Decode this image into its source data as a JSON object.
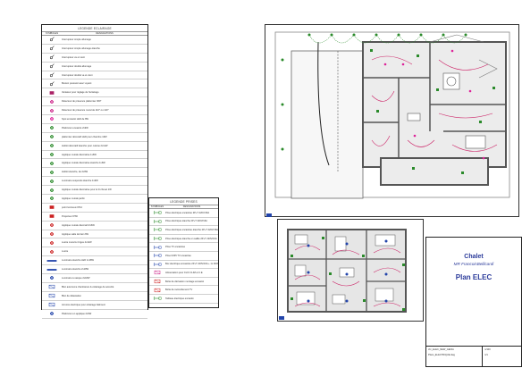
{
  "legend_eclairage": {
    "title": "LEGENDE ECLAIRAGE",
    "col_symbols": "SYMBOLES",
    "col_designations": "DESIGNATIONS",
    "items": [
      {
        "label": "Interrupteur simple allumage",
        "icon": "switch-single-icon",
        "color": "#222222"
      },
      {
        "label": "Interrupteur simple allumage étanche",
        "icon": "switch-waterproof-icon",
        "color": "#222222"
      },
      {
        "label": "Interrupteur va et vient",
        "icon": "switch-two-way-icon",
        "color": "#222222"
      },
      {
        "label": "Interrupteur double allumage",
        "icon": "switch-double-icon",
        "color": "#222222"
      },
      {
        "label": "Interrupteur double va et vient",
        "icon": "switch-double-two-way-icon",
        "color": "#222222"
      },
      {
        "label": "Bouton poussoir avec voyant",
        "icon": "push-button-icon",
        "color": "#222222"
      },
      {
        "label": "Variateur pour réglage de l'éclairage",
        "icon": "dimmer-icon",
        "color": "#aa2266"
      },
      {
        "label": "Détecteur de présence plafonnier 360°",
        "icon": "detector-360-icon",
        "color": "#cc2288"
      },
      {
        "label": "Détecteur de présence mural de 110° ou 120°",
        "icon": "detector-wall-icon",
        "color": "#cc2288"
      },
      {
        "label": "Spot encastré LED de 8W",
        "icon": "spot-led-icon",
        "color": "#dd2299"
      },
      {
        "label": "Plafonnier encastré 2x9W",
        "icon": "ceiling-recessed-icon",
        "color": "#2a8a2a"
      },
      {
        "label": "plafonnier décoratif LED pour chambre 16W",
        "icon": "ceiling-decor-icon",
        "color": "#2a8a2a"
      },
      {
        "label": "Hublot décoratif étanche pour cuisine 2x11W",
        "icon": "porthole-icon",
        "color": "#2a8a2a"
      },
      {
        "label": "Applique murale décorative 1x6W",
        "icon": "wall-light-icon",
        "color": "#2a8a2a"
      },
      {
        "label": "Applique murale décorative étanche 1x6W",
        "icon": "wall-light-waterproof-icon",
        "color": "#2a8a2a"
      },
      {
        "label": "Hublot étanche, de 2x9W",
        "icon": "porthole-waterproof-icon",
        "color": "#2a8a2a"
      },
      {
        "label": "Luminaire suspendu étanche 1x9W",
        "icon": "pendant-waterproof-icon",
        "color": "#2a8a2a"
      },
      {
        "label": "Applique murale décorative pour le lit chevet 1W",
        "icon": "bedside-light-icon",
        "color": "#2a8a2a"
      },
      {
        "label": "Applique murale jardin",
        "icon": "garden-light-icon",
        "color": "#2a8a2a"
      },
      {
        "label": "point lumineux IP44",
        "icon": "light-point-icon",
        "color": "#cc2222"
      },
      {
        "label": "Projecteur IP66",
        "icon": "projector-icon",
        "color": "#cc2222"
      },
      {
        "label": "Applique murale décoratif 2x6W",
        "icon": "wall-decor-icon",
        "color": "#cc2222"
      },
      {
        "label": "Applique salle de bain 6W",
        "icon": "bathroom-light-icon",
        "color": "#cc2222"
      },
      {
        "label": "Lustre mural à 4 tiges 4x11W",
        "icon": "chandelier-wall-icon",
        "color": "#cc2222"
      },
      {
        "label": "Lustre",
        "icon": "chandelier-icon",
        "color": "#cc2222"
      },
      {
        "label": "Luminaire étanche LED 1x18W",
        "icon": "led-batten-icon",
        "color": "#2244aa"
      },
      {
        "label": "Luminaire étanche 2x18W",
        "icon": "batten-double-icon",
        "color": "#2244aa"
      },
      {
        "label": "Luminaire à vasque 2x18W",
        "icon": "basin-light-icon",
        "color": "#2244aa"
      },
      {
        "label": "Bloc autonome d'ambiance & éclairage de sécurité",
        "icon": "emergency-block-icon",
        "color": "#2244aa"
      },
      {
        "label": "Bloc de délestation",
        "icon": "shedding-block-icon",
        "color": "#2244aa"
      },
      {
        "label": "Armoire électrique pour éclairage bâtiment",
        "icon": "electric-cabinet-icon",
        "color": "#2244aa"
      },
      {
        "label": "Plafonnier en applique 2x9W",
        "icon": "ceiling-wall-icon",
        "color": "#2244aa"
      }
    ]
  },
  "legend_prises": {
    "title": "LEGENDE PRISES",
    "col_symbols": "SYMBOLES",
    "col_designations": "DESIGNATIONS",
    "items": [
      {
        "label": "Prise électrique encastrée 2P+T 220V/16A",
        "icon": "outlet-icon",
        "color": "#2a8a2a"
      },
      {
        "label": "Prise électrique étanche 2P+T 220V/16A",
        "icon": "outlet-waterproof-icon",
        "color": "#2a8a2a"
      },
      {
        "label": "Prise électrique encastrée étanche 2P+T 220V/16A",
        "icon": "outlet-recessed-waterproof-icon",
        "color": "#2a8a2a"
      },
      {
        "label": "Prise électrique étanche en saillie 2P+T 220V/16A",
        "icon": "outlet-surface-icon",
        "color": "#2a8a2a"
      },
      {
        "label": "Prise TV encastrée",
        "icon": "tv-outlet-icon",
        "color": "#2244aa"
      },
      {
        "label": "Prise RJ45 TV encastrée",
        "icon": "rj45-outlet-icon",
        "color": "#2244aa"
      },
      {
        "label": "Box électrique encastrée 2P+T 220V/16A + 1x RJ45",
        "icon": "floor-box-icon",
        "color": "#2244aa"
      },
      {
        "label": "Alimentation pour CLIC CLIM et C.E",
        "icon": "power-supply-icon",
        "color": "#cc2288"
      },
      {
        "label": "Boîte de dérivation montage encastré",
        "icon": "junction-box-icon",
        "color": "#cc2222"
      },
      {
        "label": "Boîte de raccordement TV",
        "icon": "tv-junction-icon",
        "color": "#cc2222"
      },
      {
        "label": "Tableau électrique encastré",
        "icon": "electrical-panel-icon",
        "color": "#2a8a2a"
      }
    ]
  },
  "cartouche": {
    "title": "Chalet",
    "owner": "MR FrancoisBellicardi",
    "plan_label": "Plan ELEC",
    "footer_left": "chr_ELEC_NEW_GENIA",
    "footer_file": "Plans_ELECTRIQUE.dwg",
    "footer_right_top": "1/100",
    "footer_right_bottom": "1/1"
  },
  "colors": {
    "wall": "#555555",
    "wire": "#cc2266",
    "green_symbol": "#2a8a2a",
    "accent_blue": "#2a3a9a",
    "floor_fill": "#e6e6e6"
  }
}
